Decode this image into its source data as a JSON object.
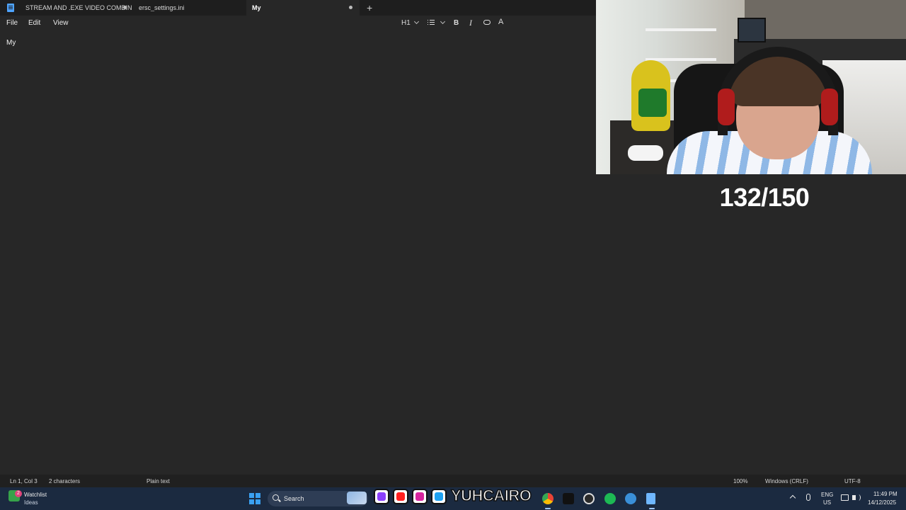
{
  "tabs": [
    {
      "label": "STREAM AND .EXE VIDEO COMBINA",
      "modified": true
    },
    {
      "label": "ersc_settings.ini",
      "modified": false
    },
    {
      "label": "My",
      "modified": true,
      "active": true
    }
  ],
  "new_tab_label": "+",
  "menu": {
    "file": "File",
    "edit": "Edit",
    "view": "View"
  },
  "format_toolbar": {
    "heading": "H1",
    "bold": "B",
    "italic": "I",
    "clear": "A"
  },
  "editor": {
    "content": "My"
  },
  "status": {
    "position": "Ln 1, Col 3",
    "characters": "2 characters",
    "format": "Plain text",
    "zoom": "100%",
    "line_endings": "Windows (CRLF)",
    "encoding": "UTF-8"
  },
  "overlay": {
    "counter": "132/150"
  },
  "taskbar": {
    "widget_badge": "2",
    "widget_title": "Watchlist",
    "widget_subtitle": "Ideas",
    "search_label": "Search",
    "banner_text": "YUHCAIRO",
    "language": "ENG",
    "region": "US",
    "time": "11:49 PM",
    "date": "14/12/2025"
  },
  "colors": {
    "editor_bg": "#272727",
    "tabbar_bg": "#1e1e1e",
    "taskbar_bg": "#1b2a40",
    "accent": "#4ea3ff"
  }
}
